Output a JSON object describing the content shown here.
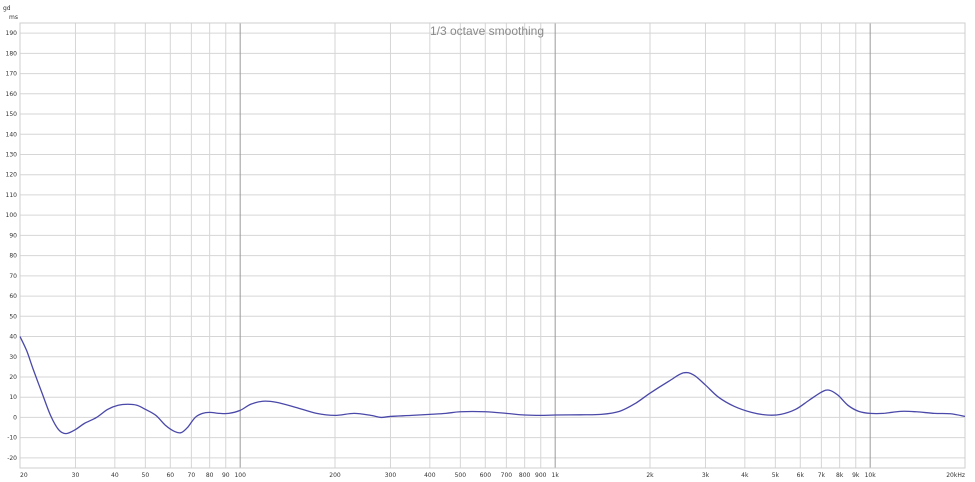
{
  "chart_data": {
    "type": "line",
    "title": "1/3 octave smoothing",
    "ylabel": "gd",
    "yunit": "ms",
    "xscale": "log",
    "xlim": [
      20,
      20000
    ],
    "ylim": [
      -25,
      195
    ],
    "grid": true,
    "y_ticks": [
      "190",
      "180",
      "170",
      "160",
      "150",
      "140",
      "130",
      "120",
      "110",
      "100",
      "90",
      "80",
      "70",
      "60",
      "50",
      "40",
      "30",
      "20",
      "10",
      "0",
      "-10",
      "-20"
    ],
    "x_ticks": [
      {
        "v": 20,
        "label": "20"
      },
      {
        "v": 30,
        "label": "30"
      },
      {
        "v": 40,
        "label": "40"
      },
      {
        "v": 50,
        "label": "50"
      },
      {
        "v": 60,
        "label": "60"
      },
      {
        "v": 70,
        "label": "70"
      },
      {
        "v": 80,
        "label": "80"
      },
      {
        "v": 90,
        "label": "90"
      },
      {
        "v": 100,
        "label": "100"
      },
      {
        "v": 200,
        "label": "200"
      },
      {
        "v": 300,
        "label": "300"
      },
      {
        "v": 400,
        "label": "400"
      },
      {
        "v": 500,
        "label": "500"
      },
      {
        "v": 600,
        "label": "600"
      },
      {
        "v": 700,
        "label": "700"
      },
      {
        "v": 800,
        "label": "800"
      },
      {
        "v": 900,
        "label": "900"
      },
      {
        "v": 1000,
        "label": "1k"
      },
      {
        "v": 2000,
        "label": "2k"
      },
      {
        "v": 3000,
        "label": "3k"
      },
      {
        "v": 4000,
        "label": "4k"
      },
      {
        "v": 5000,
        "label": "5k"
      },
      {
        "v": 6000,
        "label": "6k"
      },
      {
        "v": 7000,
        "label": "7k"
      },
      {
        "v": 8000,
        "label": "8k"
      },
      {
        "v": 9000,
        "label": "9k"
      },
      {
        "v": 10000,
        "label": "10k"
      },
      {
        "v": 20000,
        "label": "20kHz"
      }
    ],
    "series": [
      {
        "color": "#4a48a8",
        "points": [
          [
            20,
            40
          ],
          [
            21,
            33
          ],
          [
            22,
            24
          ],
          [
            23.5,
            12
          ],
          [
            25,
            1
          ],
          [
            26.5,
            -6
          ],
          [
            28,
            -8
          ],
          [
            30,
            -6
          ],
          [
            32,
            -3
          ],
          [
            35,
            0
          ],
          [
            38,
            4
          ],
          [
            41,
            6
          ],
          [
            44,
            6.5
          ],
          [
            47,
            6
          ],
          [
            50,
            4
          ],
          [
            54,
            1
          ],
          [
            58,
            -4
          ],
          [
            62,
            -7
          ],
          [
            65,
            -7.5
          ],
          [
            68,
            -5
          ],
          [
            72,
            0
          ],
          [
            76,
            2
          ],
          [
            80,
            2.5
          ],
          [
            86,
            2
          ],
          [
            92,
            2
          ],
          [
            100,
            3.5
          ],
          [
            108,
            6.5
          ],
          [
            118,
            8
          ],
          [
            130,
            7.5
          ],
          [
            150,
            5
          ],
          [
            175,
            2
          ],
          [
            200,
            1
          ],
          [
            230,
            2
          ],
          [
            260,
            1
          ],
          [
            280,
            0
          ],
          [
            300,
            0.5
          ],
          [
            350,
            1
          ],
          [
            400,
            1.5
          ],
          [
            450,
            2
          ],
          [
            500,
            2.8
          ],
          [
            600,
            2.8
          ],
          [
            700,
            2
          ],
          [
            800,
            1.2
          ],
          [
            900,
            1
          ],
          [
            1000,
            1.2
          ],
          [
            1200,
            1.3
          ],
          [
            1400,
            1.5
          ],
          [
            1600,
            3
          ],
          [
            1800,
            7
          ],
          [
            2000,
            12
          ],
          [
            2300,
            18
          ],
          [
            2550,
            22
          ],
          [
            2750,
            21
          ],
          [
            3000,
            16
          ],
          [
            3300,
            10
          ],
          [
            3700,
            5.5
          ],
          [
            4200,
            2.5
          ],
          [
            4700,
            1.2
          ],
          [
            5200,
            1.5
          ],
          [
            5800,
            4
          ],
          [
            6400,
            8.5
          ],
          [
            7000,
            12.5
          ],
          [
            7400,
            13.5
          ],
          [
            7900,
            11
          ],
          [
            8500,
            6
          ],
          [
            9200,
            3
          ],
          [
            10000,
            2
          ],
          [
            11000,
            2
          ],
          [
            12500,
            3
          ],
          [
            14000,
            2.8
          ],
          [
            16000,
            2
          ],
          [
            18000,
            1.8
          ],
          [
            20000,
            0.5
          ]
        ]
      }
    ]
  }
}
